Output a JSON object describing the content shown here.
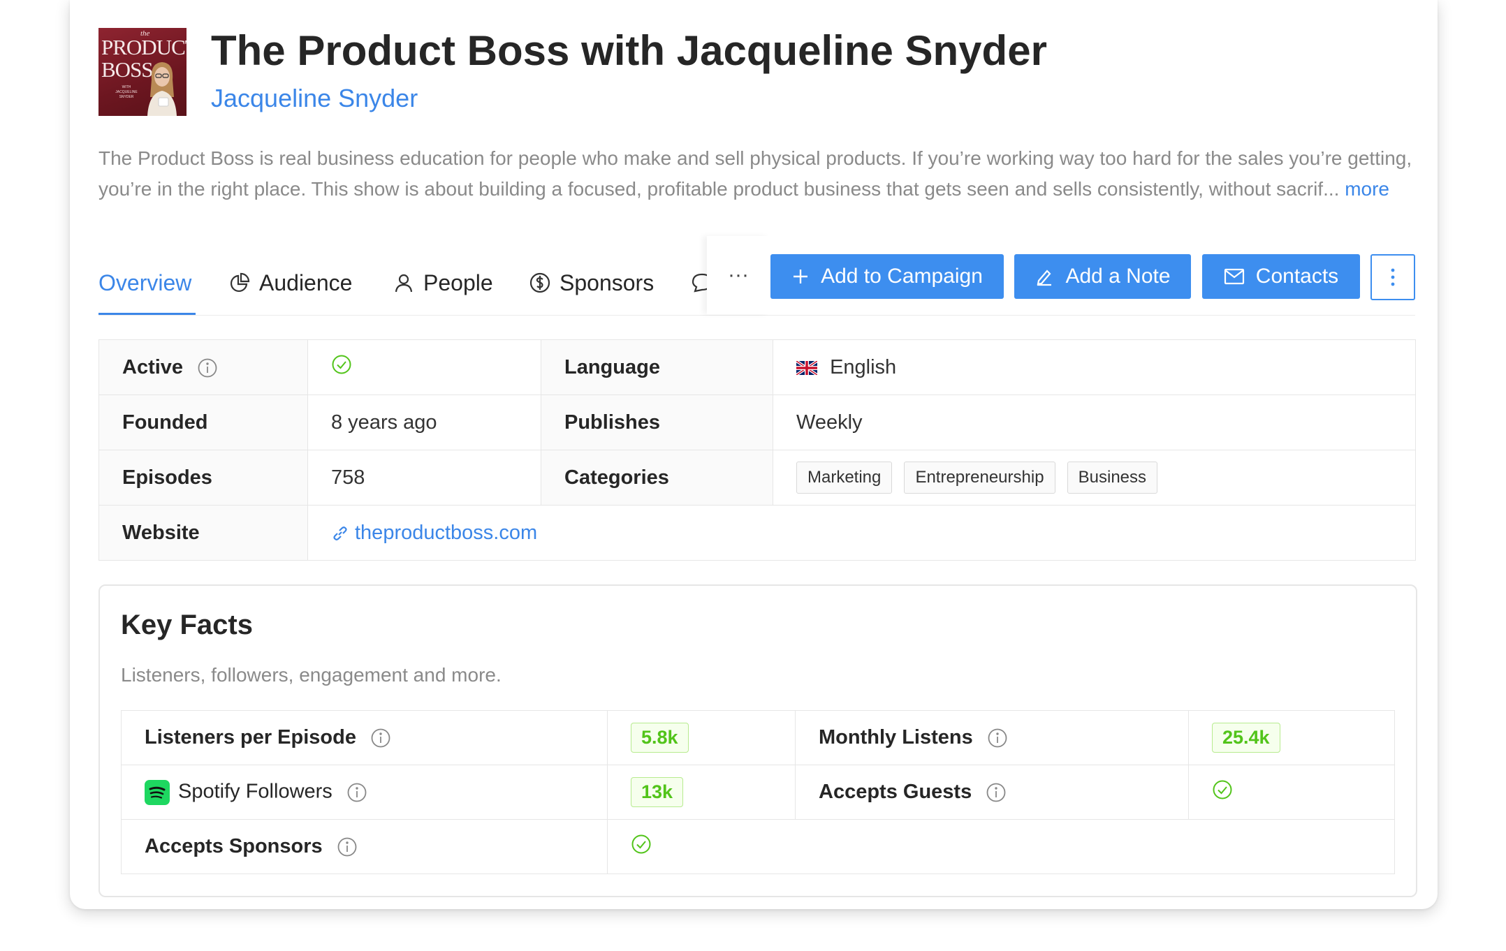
{
  "podcast": {
    "cover": {
      "text_small": "the",
      "text_line1": "PRODUCT",
      "text_line2": "BOSS",
      "text_sub": "WITH JACQUELINE SNYDER"
    },
    "title": "The Product Boss with Jacqueline Snyder",
    "author": "Jacqueline Snyder",
    "description": "The Product Boss is real business education for people who make and sell physical products. If you’re working way too hard for the sales you’re getting, you’re in the right place. This show is about building a focused, profitable product business that gets seen and sells consistently, without sacrif...",
    "more_label": "more"
  },
  "tabs": [
    {
      "label": "Overview",
      "icon": "none",
      "active": true
    },
    {
      "label": "Audience",
      "icon": "pie-chart-icon",
      "active": false
    },
    {
      "label": "People",
      "icon": "user-icon",
      "active": false
    },
    {
      "label": "Sponsors",
      "icon": "dollar-circle-icon",
      "active": false
    }
  ],
  "tabs_overflow_label": "···",
  "actions": {
    "add_campaign": "Add to Campaign",
    "add_note": "Add a Note",
    "contacts": "Contacts"
  },
  "info": {
    "active_label": "Active",
    "language_label": "Language",
    "language_value": "English",
    "founded_label": "Founded",
    "founded_value": "8 years ago",
    "publishes_label": "Publishes",
    "publishes_value": "Weekly",
    "episodes_label": "Episodes",
    "episodes_value": "758",
    "categories_label": "Categories",
    "categories": [
      "Marketing",
      "Entrepreneurship",
      "Business"
    ],
    "website_label": "Website",
    "website_value": "theproductboss.com"
  },
  "key_facts": {
    "title": "Key Facts",
    "subtitle": "Listeners, followers, engagement and more.",
    "listeners_label": "Listeners per Episode",
    "listeners_value": "5.8k",
    "monthly_label": "Monthly Listens",
    "monthly_value": "25.4k",
    "spotify_label": "Spotify Followers",
    "spotify_value": "13k",
    "guests_label": "Accepts Guests",
    "sponsors_label": "Accepts Sponsors"
  },
  "colors": {
    "accent": "#3d8eef",
    "link": "#3b86e8",
    "success": "#52c41a",
    "cover_bg": "#7a1c26"
  }
}
